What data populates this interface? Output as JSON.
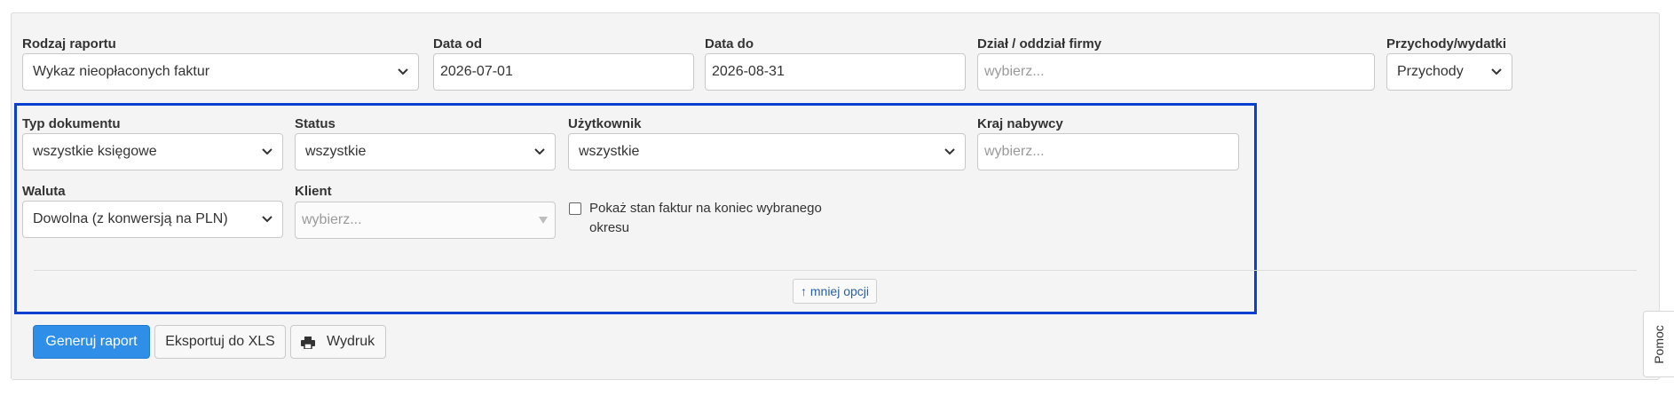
{
  "filters": {
    "report_type": {
      "label": "Rodzaj raportu",
      "value": "Wykaz nieopłaconych faktur"
    },
    "date_from": {
      "label": "Data od",
      "value": "2026-07-01"
    },
    "date_to": {
      "label": "Data do",
      "value": "2026-08-31"
    },
    "department": {
      "label": "Dział / oddział firmy",
      "placeholder": "wybierz..."
    },
    "income_expense": {
      "label": "Przychody/wydatki",
      "value": "Przychody"
    }
  },
  "more_options": {
    "document_type": {
      "label": "Typ dokumentu",
      "value": "wszystkie księgowe"
    },
    "status": {
      "label": "Status",
      "value": "wszystkie"
    },
    "user": {
      "label": "Użytkownik",
      "value": "wszystkie"
    },
    "buyer_country": {
      "label": "Kraj nabywcy",
      "placeholder": "wybierz..."
    },
    "currency": {
      "label": "Waluta",
      "value": "Dowolna (z konwersją na PLN)"
    },
    "client": {
      "label": "Klient",
      "placeholder": "wybierz..."
    },
    "show_state_checkbox": {
      "label_line1": "Pokaż stan faktur na koniec wybranego",
      "label_line2": "okresu",
      "checked": false
    },
    "less_options_label": "↑ mniej opcji"
  },
  "actions": {
    "generate_label": "Generuj raport",
    "export_label": "Eksportuj do XLS",
    "print_label": "Wydruk"
  },
  "help_tab_label": "Pomoc",
  "colors": {
    "primary": "#2e8ee8",
    "highlight_border": "#0a3fcf",
    "panel_bg": "#f4f4f4"
  },
  "icons": {
    "print": "printer-icon",
    "select": "chevron-down-icon"
  }
}
